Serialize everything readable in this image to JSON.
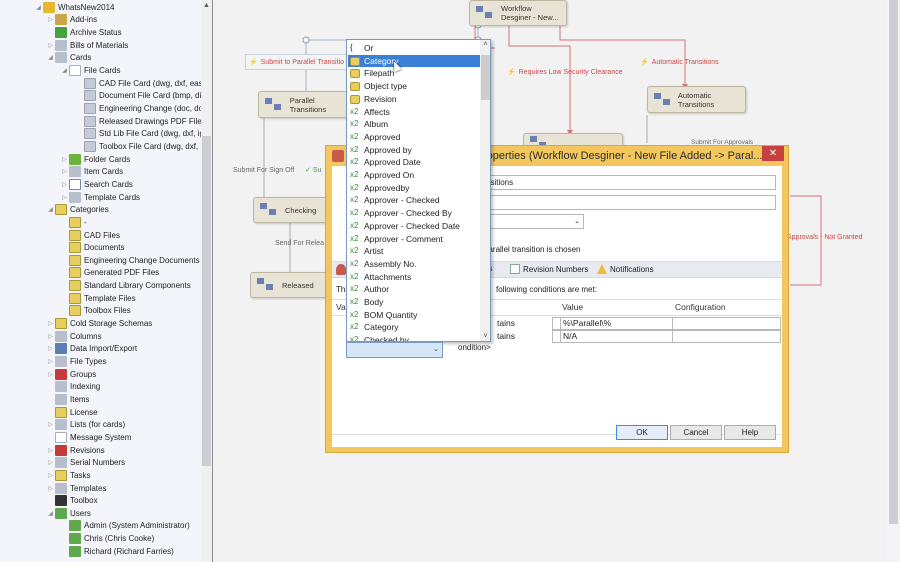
{
  "tree": {
    "items": [
      {
        "label": "WhatsNew2014",
        "icon": "database-icon",
        "expander": "expanded",
        "level": 0
      },
      {
        "label": "Add-ins",
        "icon": "add-ins-icon",
        "expander": "collapsed",
        "level": 1
      },
      {
        "label": "Archive Status",
        "icon": "archive-status-icon",
        "expander": "none",
        "level": 1
      },
      {
        "label": "Bills of Materials",
        "icon": "bom-icon",
        "expander": "collapsed",
        "level": 1
      },
      {
        "label": "Cards",
        "icon": "cards-icon",
        "expander": "expanded",
        "level": 1
      },
      {
        "label": "File Cards",
        "icon": "file-cards-icon",
        "expander": "expanded",
        "level": 2
      },
      {
        "label": "CAD File Card  (dwg, dxf, eas",
        "icon": "card-icon",
        "expander": "none",
        "level": 3
      },
      {
        "label": "Document File Card  (bmp, dib",
        "icon": "card-icon",
        "expander": "none",
        "level": 3
      },
      {
        "label": "Engineering Change  (doc, do",
        "icon": "card-icon",
        "expander": "none",
        "level": 3
      },
      {
        "label": "Released Drawings PDF File Ca",
        "icon": "card-icon",
        "expander": "none",
        "level": 3
      },
      {
        "label": "Std Lib File Card  (dwg, dxf, ig",
        "icon": "card-icon",
        "expander": "none",
        "level": 3
      },
      {
        "label": "Toolbox File Card  (dwg, dxf,",
        "icon": "card-icon",
        "expander": "none",
        "level": 3
      },
      {
        "label": "Folder Cards",
        "icon": "folder-cards-icon",
        "expander": "collapsed",
        "level": 2
      },
      {
        "label": "Item Cards",
        "icon": "item-cards-icon",
        "expander": "collapsed",
        "level": 2
      },
      {
        "label": "Search Cards",
        "icon": "search-cards-icon",
        "expander": "collapsed",
        "level": 2
      },
      {
        "label": "Template Cards",
        "icon": "template-cards-icon",
        "expander": "collapsed",
        "level": 2
      },
      {
        "label": "Categories",
        "icon": "categories-icon",
        "expander": "expanded",
        "level": 1
      },
      {
        "label": "-",
        "icon": "category-icon",
        "expander": "none",
        "level": 2
      },
      {
        "label": "CAD Files",
        "icon": "category-icon",
        "expander": "none",
        "level": 2
      },
      {
        "label": "Documents",
        "icon": "category-icon",
        "expander": "none",
        "level": 2
      },
      {
        "label": "Engineering Change Documents",
        "icon": "category-icon",
        "expander": "none",
        "level": 2
      },
      {
        "label": "Generated PDF Files",
        "icon": "category-icon",
        "expander": "none",
        "level": 2
      },
      {
        "label": "Standard Library Components",
        "icon": "category-icon",
        "expander": "none",
        "level": 2
      },
      {
        "label": "Template Files",
        "icon": "category-icon",
        "expander": "none",
        "level": 2
      },
      {
        "label": "Toolbox Files",
        "icon": "category-icon",
        "expander": "none",
        "level": 2
      },
      {
        "label": "Cold Storage Schemas",
        "icon": "cold-storage-icon",
        "expander": "collapsed",
        "level": 1
      },
      {
        "label": "Columns",
        "icon": "columns-icon",
        "expander": "collapsed",
        "level": 1
      },
      {
        "label": "Data Import/Export",
        "icon": "data-import-export-icon",
        "expander": "collapsed",
        "level": 1
      },
      {
        "label": "File Types",
        "icon": "file-types-icon",
        "expander": "collapsed",
        "level": 1
      },
      {
        "label": "Groups",
        "icon": "groups-icon",
        "expander": "collapsed",
        "level": 1
      },
      {
        "label": "Indexing",
        "icon": "indexing-icon",
        "expander": "none",
        "level": 1
      },
      {
        "label": "Items",
        "icon": "items-icon",
        "expander": "none",
        "level": 1
      },
      {
        "label": "License",
        "icon": "license-icon",
        "expander": "none",
        "level": 1
      },
      {
        "label": "Lists (for cards)",
        "icon": "lists-icon",
        "expander": "collapsed",
        "level": 1
      },
      {
        "label": "Message System",
        "icon": "message-system-icon",
        "expander": "none",
        "level": 1
      },
      {
        "label": "Revisions",
        "icon": "revisions-icon",
        "expander": "collapsed",
        "level": 1
      },
      {
        "label": "Serial Numbers",
        "icon": "serial-numbers-icon",
        "expander": "collapsed",
        "level": 1
      },
      {
        "label": "Tasks",
        "icon": "tasks-icon",
        "expander": "collapsed",
        "level": 1
      },
      {
        "label": "Templates",
        "icon": "templates-icon",
        "expander": "collapsed",
        "level": 1
      },
      {
        "label": "Toolbox",
        "icon": "toolbox-icon",
        "expander": "none",
        "level": 1
      },
      {
        "label": "Users",
        "icon": "users-icon",
        "expander": "expanded",
        "level": 1
      },
      {
        "label": "Admin (System Administrator)",
        "icon": "user-icon",
        "expander": "none",
        "level": 2
      },
      {
        "label": "Chris (Chris Cooke)",
        "icon": "user-icon",
        "expander": "none",
        "level": 2
      },
      {
        "label": "Richard (Richard Farries)",
        "icon": "user-icon",
        "expander": "none",
        "level": 2
      }
    ]
  },
  "workflow": {
    "nodes": {
      "workflow_designer": "Workflow\nDesginer - New...",
      "parallel_transitions": "Parallel Transitions",
      "automatic_transitions": "Automatic Transitions",
      "checking": "Checking",
      "released": "Released"
    },
    "transitions": {
      "submit_parallel": "Submit to Parallel Transitio",
      "requires_low_security": "Requires Low Security Clearance",
      "automatic_transitions": "Automatic Transitions",
      "submit_for_sign_off": "Submit For Sign Off",
      "submit_partial": "Su",
      "send_for_release": "Send For Relea",
      "submit_for_approvals": "Submit For Approvals",
      "approvals_not_granted": "Approvals -  Not Granted"
    },
    "colors": {
      "transition_red": "#c74a4a",
      "node_fill": "#e8e4d5"
    }
  },
  "dialog": {
    "title": "roperties (Workflow Desginer - New File Added -> Paral...",
    "close_label": "✕",
    "name_value": "nsitions",
    "description_value": "",
    "parallel_note": "parallel transition is chosen",
    "tabs": [
      {
        "label": "ns",
        "icon": "conditions-icon"
      },
      {
        "label": "Revision Numbers",
        "icon": "revision-numbers-icon"
      },
      {
        "label": "Notifications",
        "icon": "notifications-icon"
      }
    ],
    "conditions_intro_left": "Thi",
    "conditions_intro_right": "following conditions are met:",
    "grid": {
      "headers": {
        "variable": "Va",
        "condition": "n",
        "value": "Value",
        "configuration": "Configuration"
      },
      "rows": [
        {
          "condition": "tains",
          "value": "%\\Parallel\\%",
          "configuration": ""
        },
        {
          "condition": "tains",
          "value": "N/A",
          "configuration": ""
        }
      ],
      "new_condition_label": "ondition>"
    },
    "buttons": {
      "ok": "OK",
      "cancel": "Cancel",
      "help": "Help"
    },
    "accent": "#f3c75e"
  },
  "dropdown": {
    "selected_index": 1,
    "items": [
      {
        "label": "Or",
        "kind": "brace"
      },
      {
        "label": "Category",
        "kind": "category"
      },
      {
        "label": "Filepath",
        "kind": "category"
      },
      {
        "label": "Object type",
        "kind": "category"
      },
      {
        "label": "Revision",
        "kind": "category"
      },
      {
        "label": "Affects",
        "kind": "x2"
      },
      {
        "label": "Album",
        "kind": "x2"
      },
      {
        "label": "Approved",
        "kind": "x2"
      },
      {
        "label": "Approved by",
        "kind": "x2"
      },
      {
        "label": "Approved Date",
        "kind": "x2"
      },
      {
        "label": "Approved On",
        "kind": "x2"
      },
      {
        "label": "Approvedby",
        "kind": "x2"
      },
      {
        "label": "Approver - Checked",
        "kind": "x2"
      },
      {
        "label": "Approver - Checked By",
        "kind": "x2"
      },
      {
        "label": "Approver - Checked Date",
        "kind": "x2"
      },
      {
        "label": "Approver - Comment",
        "kind": "x2"
      },
      {
        "label": "Artist",
        "kind": "x2"
      },
      {
        "label": "Assembly No.",
        "kind": "x2"
      },
      {
        "label": "Attachments",
        "kind": "x2"
      },
      {
        "label": "Author",
        "kind": "x2"
      },
      {
        "label": "Body",
        "kind": "x2"
      },
      {
        "label": "BOM Quantity",
        "kind": "x2"
      },
      {
        "label": "Category",
        "kind": "x2"
      },
      {
        "label": "Checked by",
        "kind": "x2"
      }
    ],
    "prefix_x2": "x2",
    "prefix_brace": "{",
    "selected_color": "#3a80d6"
  },
  "combo": {
    "value": ""
  }
}
